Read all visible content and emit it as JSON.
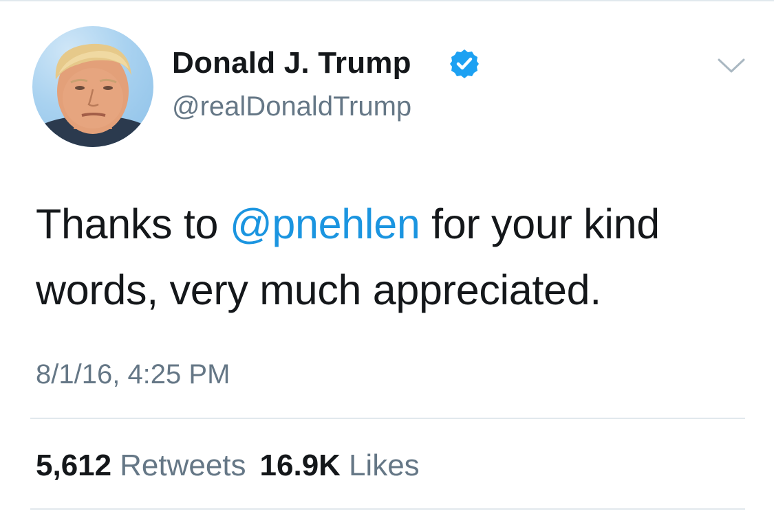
{
  "tweet": {
    "author": {
      "display_name": "Donald J. Trump",
      "handle": "@realDonaldTrump",
      "verified": true,
      "avatar_icon": "profile-photo-avatar"
    },
    "menu_icon": "chevron-down-icon",
    "text": {
      "prefix": "Thanks to ",
      "mention": "@pnehlen",
      "suffix": " for your kind words, very much appreciated."
    },
    "timestamp": "8/1/16, 4:25 PM",
    "stats": {
      "retweets_count": "5,612",
      "retweets_label": "Retweets",
      "likes_count": "16.9K",
      "likes_label": "Likes"
    }
  },
  "colors": {
    "text_primary": "#14171a",
    "text_secondary": "#657786",
    "link": "#1b95e0",
    "verified_badge": "#1da1f2",
    "divider": "#e1e8ed"
  }
}
